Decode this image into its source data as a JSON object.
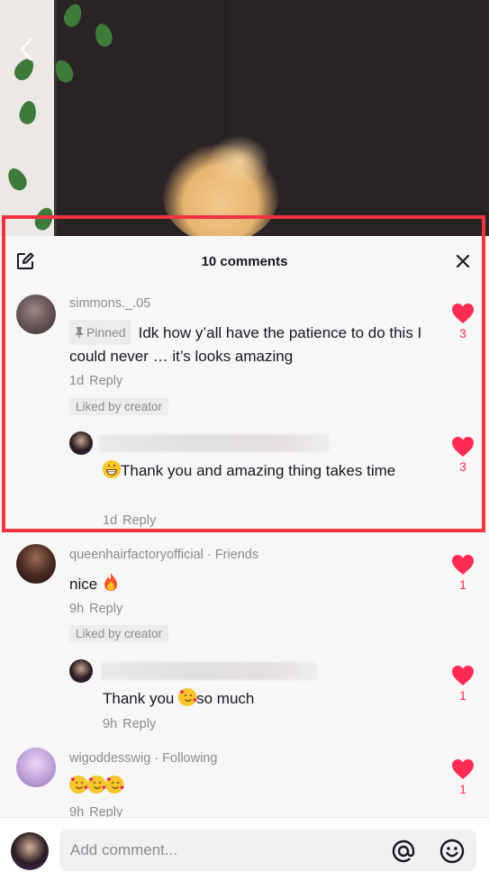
{
  "panel": {
    "title": "10 comments"
  },
  "comments": [
    {
      "username": "simmons._.05",
      "pinned_label": "Pinned",
      "text": "Idk how y’all have the patience to do this I could never … it’s looks amazing",
      "time": "1d",
      "reply_label": "Reply",
      "liked_by_creator": "Liked by creator",
      "likes": "3"
    },
    {
      "username": "",
      "text": "Thank you and amazing thing takes time",
      "time": "1d",
      "reply_label": "Reply",
      "likes": "3"
    },
    {
      "username": "queenhairfactoryofficial",
      "relation": "· Friends",
      "text": "nice",
      "time": "9h",
      "reply_label": "Reply",
      "liked_by_creator": "Liked by creator",
      "likes": "1"
    },
    {
      "username": "",
      "text_before": "Thank you",
      "text_after": "so much",
      "time": "9h",
      "reply_label": "Reply",
      "likes": "1"
    },
    {
      "username": "wigoddesswig",
      "relation": "· Following",
      "time": "9h",
      "reply_label": "Reply",
      "likes": "1"
    }
  ],
  "composer": {
    "placeholder": "Add comment..."
  },
  "icons": {
    "back": "chevron-left-icon",
    "edit": "edit-icon",
    "close": "close-icon",
    "like": "heart-icon",
    "mention": "at-sign-icon",
    "emoji": "smiley-icon"
  },
  "colors": {
    "like": "#fe2c55",
    "highlight": "#ef3340",
    "secondary_text": "#8a8b91"
  }
}
